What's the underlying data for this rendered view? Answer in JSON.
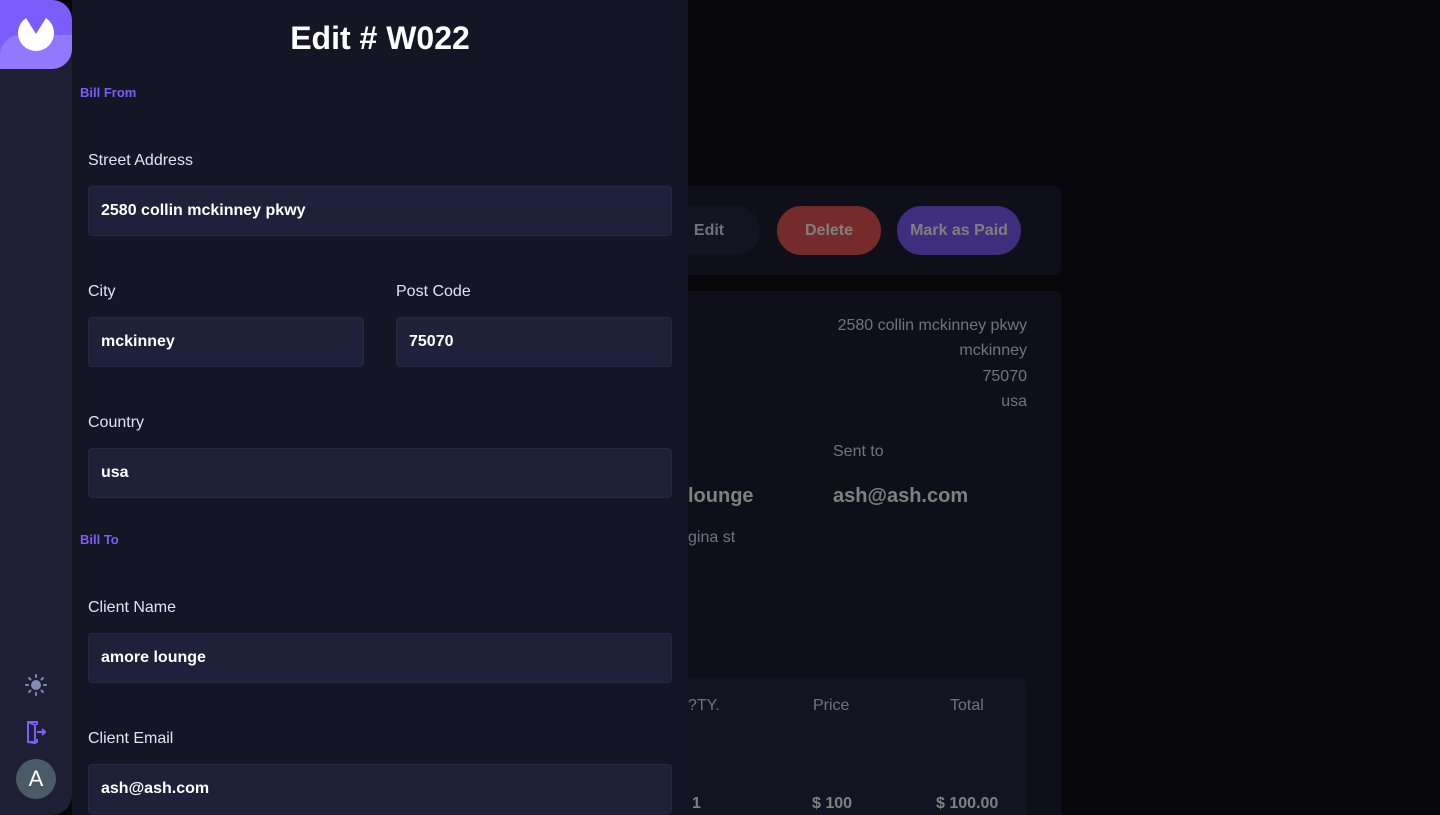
{
  "drawer": {
    "title": "Edit # W022",
    "bill_from_label": "Bill From",
    "bill_to_label": "Bill To",
    "fields": {
      "street_label": "Street Address",
      "street_value": "2580 collin mckinney pkwy",
      "city_label": "City",
      "city_value": "mckinney",
      "postcode_label": "Post Code",
      "postcode_value": "75070",
      "country_label": "Country",
      "country_value": "usa",
      "client_name_label": "Client Name",
      "client_name_value": "amore lounge",
      "client_email_label": "Client Email",
      "client_email_value": "ash@ash.com"
    }
  },
  "sidebar": {
    "avatar_initial": "A",
    "icons": [
      "logo-icon",
      "sun-icon",
      "logout-icon"
    ]
  },
  "invoice": {
    "actions": {
      "edit": "Edit",
      "delete": "Delete",
      "mark_paid": "Mark as Paid"
    },
    "sender_address": [
      "2580 collin mckinney pkwy",
      "mckinney",
      "75070",
      "usa"
    ],
    "sent_to_label": "Sent to",
    "sent_to_value": "ash@ash.com",
    "client_name_partial": "lounge",
    "client_street_partial": "gina st",
    "client_city_partial": "/",
    "table": {
      "headers": [
        "QTY.",
        "Price",
        "Total"
      ],
      "headers_visible": [
        "?TY.",
        "Price",
        "Total"
      ],
      "row": [
        "1",
        "$ 100",
        "$ 100.00"
      ]
    }
  },
  "colors": {
    "accent": "#7c5dfa",
    "danger": "#ec5757",
    "drawer_bg": "#141625",
    "input_bg": "#1e2139"
  }
}
